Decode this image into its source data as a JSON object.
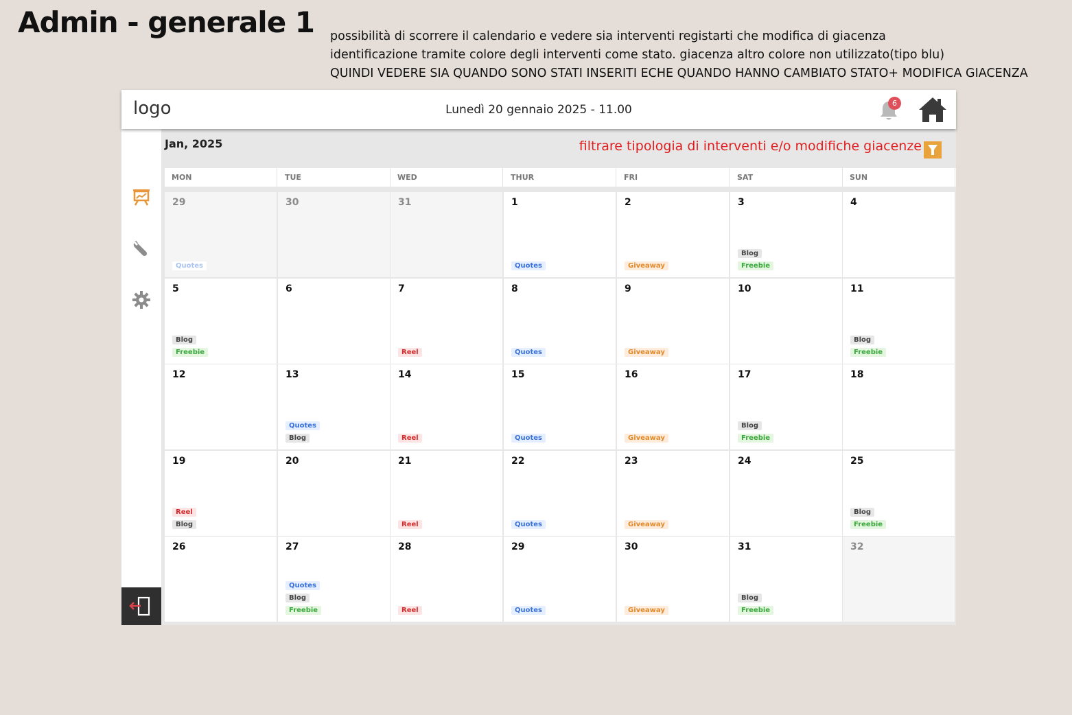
{
  "page": {
    "heading": "Admin - generale 1",
    "notes": [
      "possibilità di scorrere il calendario e vedere sia interventi registarti che modifica di giacenza",
      "identificazione tramite colore degli interventi come stato. giacenza altro colore non utilizzato(tipo blu)",
      "QUINDI VEDERE SIA QUANDO SONO STATI INSERITI ECHE QUANDO HANNO CAMBIATO STATO+ MODIFICA GIACENZA"
    ]
  },
  "topbar": {
    "logo": "logo",
    "datetime": "Lunedì 20 gennaio 2025  -  11.00",
    "notification_count": "6",
    "icons": [
      "bell-icon",
      "home-icon"
    ]
  },
  "sidebar": {
    "items": [
      {
        "icon": "presentation-chart-icon",
        "active": true
      },
      {
        "icon": "wrench-icon",
        "active": false
      },
      {
        "icon": "gear-icon",
        "active": false
      }
    ],
    "logout_icon": "logout-icon"
  },
  "calendar": {
    "month": "Jan, 2025",
    "filter_label": "filtrare tipologia di interventi e/o modifiche giacenze",
    "filter_icon": "funnel-icon",
    "weekdays": [
      "MON",
      "TUE",
      "WED",
      "THUR",
      "FRI",
      "SAT",
      "SUN"
    ],
    "tag_colors": {
      "Quotes": "#3a72d8",
      "Blog": "#444444",
      "Freebie": "#3aa83c",
      "Giveaway": "#e08a2c",
      "Reel": "#d22c2c"
    },
    "weeks": [
      [
        {
          "day": "29",
          "out": true,
          "tags": [
            "Quotes"
          ]
        },
        {
          "day": "30",
          "out": true,
          "tags": []
        },
        {
          "day": "31",
          "out": true,
          "tags": []
        },
        {
          "day": "1",
          "out": false,
          "tags": [
            "Quotes"
          ]
        },
        {
          "day": "2",
          "out": false,
          "tags": [
            "Giveaway"
          ]
        },
        {
          "day": "3",
          "out": false,
          "tags": [
            "Blog",
            "Freebie"
          ]
        },
        {
          "day": "4",
          "out": false,
          "tags": []
        }
      ],
      [
        {
          "day": "5",
          "out": false,
          "tags": [
            "Blog",
            "Freebie"
          ]
        },
        {
          "day": "6",
          "out": false,
          "tags": []
        },
        {
          "day": "7",
          "out": false,
          "tags": [
            "Reel"
          ]
        },
        {
          "day": "8",
          "out": false,
          "tags": [
            "Quotes"
          ]
        },
        {
          "day": "9",
          "out": false,
          "tags": [
            "Giveaway"
          ]
        },
        {
          "day": "10",
          "out": false,
          "tags": []
        },
        {
          "day": "11",
          "out": false,
          "tags": [
            "Blog",
            "Freebie"
          ]
        }
      ],
      [
        {
          "day": "12",
          "out": false,
          "tags": []
        },
        {
          "day": "13",
          "out": false,
          "tags": [
            "Quotes",
            "Blog"
          ]
        },
        {
          "day": "14",
          "out": false,
          "tags": [
            "Reel"
          ]
        },
        {
          "day": "15",
          "out": false,
          "tags": [
            "Quotes"
          ]
        },
        {
          "day": "16",
          "out": false,
          "tags": [
            "Giveaway"
          ]
        },
        {
          "day": "17",
          "out": false,
          "tags": [
            "Blog",
            "Freebie"
          ]
        },
        {
          "day": "18",
          "out": false,
          "tags": []
        }
      ],
      [
        {
          "day": "19",
          "out": false,
          "tags": [
            "Reel",
            "Blog"
          ]
        },
        {
          "day": "20",
          "out": false,
          "tags": []
        },
        {
          "day": "21",
          "out": false,
          "tags": [
            "Reel"
          ]
        },
        {
          "day": "22",
          "out": false,
          "tags": [
            "Quotes"
          ]
        },
        {
          "day": "23",
          "out": false,
          "tags": [
            "Giveaway"
          ]
        },
        {
          "day": "24",
          "out": false,
          "tags": []
        },
        {
          "day": "25",
          "out": false,
          "tags": [
            "Blog",
            "Freebie"
          ]
        }
      ],
      [
        {
          "day": "26",
          "out": false,
          "tags": []
        },
        {
          "day": "27",
          "out": false,
          "tags": [
            "Quotes",
            "Blog",
            "Freebie"
          ]
        },
        {
          "day": "28",
          "out": false,
          "tags": [
            "Reel"
          ]
        },
        {
          "day": "29",
          "out": false,
          "tags": [
            "Quotes"
          ]
        },
        {
          "day": "30",
          "out": false,
          "tags": [
            "Giveaway"
          ]
        },
        {
          "day": "31",
          "out": false,
          "tags": [
            "Blog",
            "Freebie"
          ]
        },
        {
          "day": "32",
          "out": true,
          "tags": []
        }
      ]
    ]
  }
}
